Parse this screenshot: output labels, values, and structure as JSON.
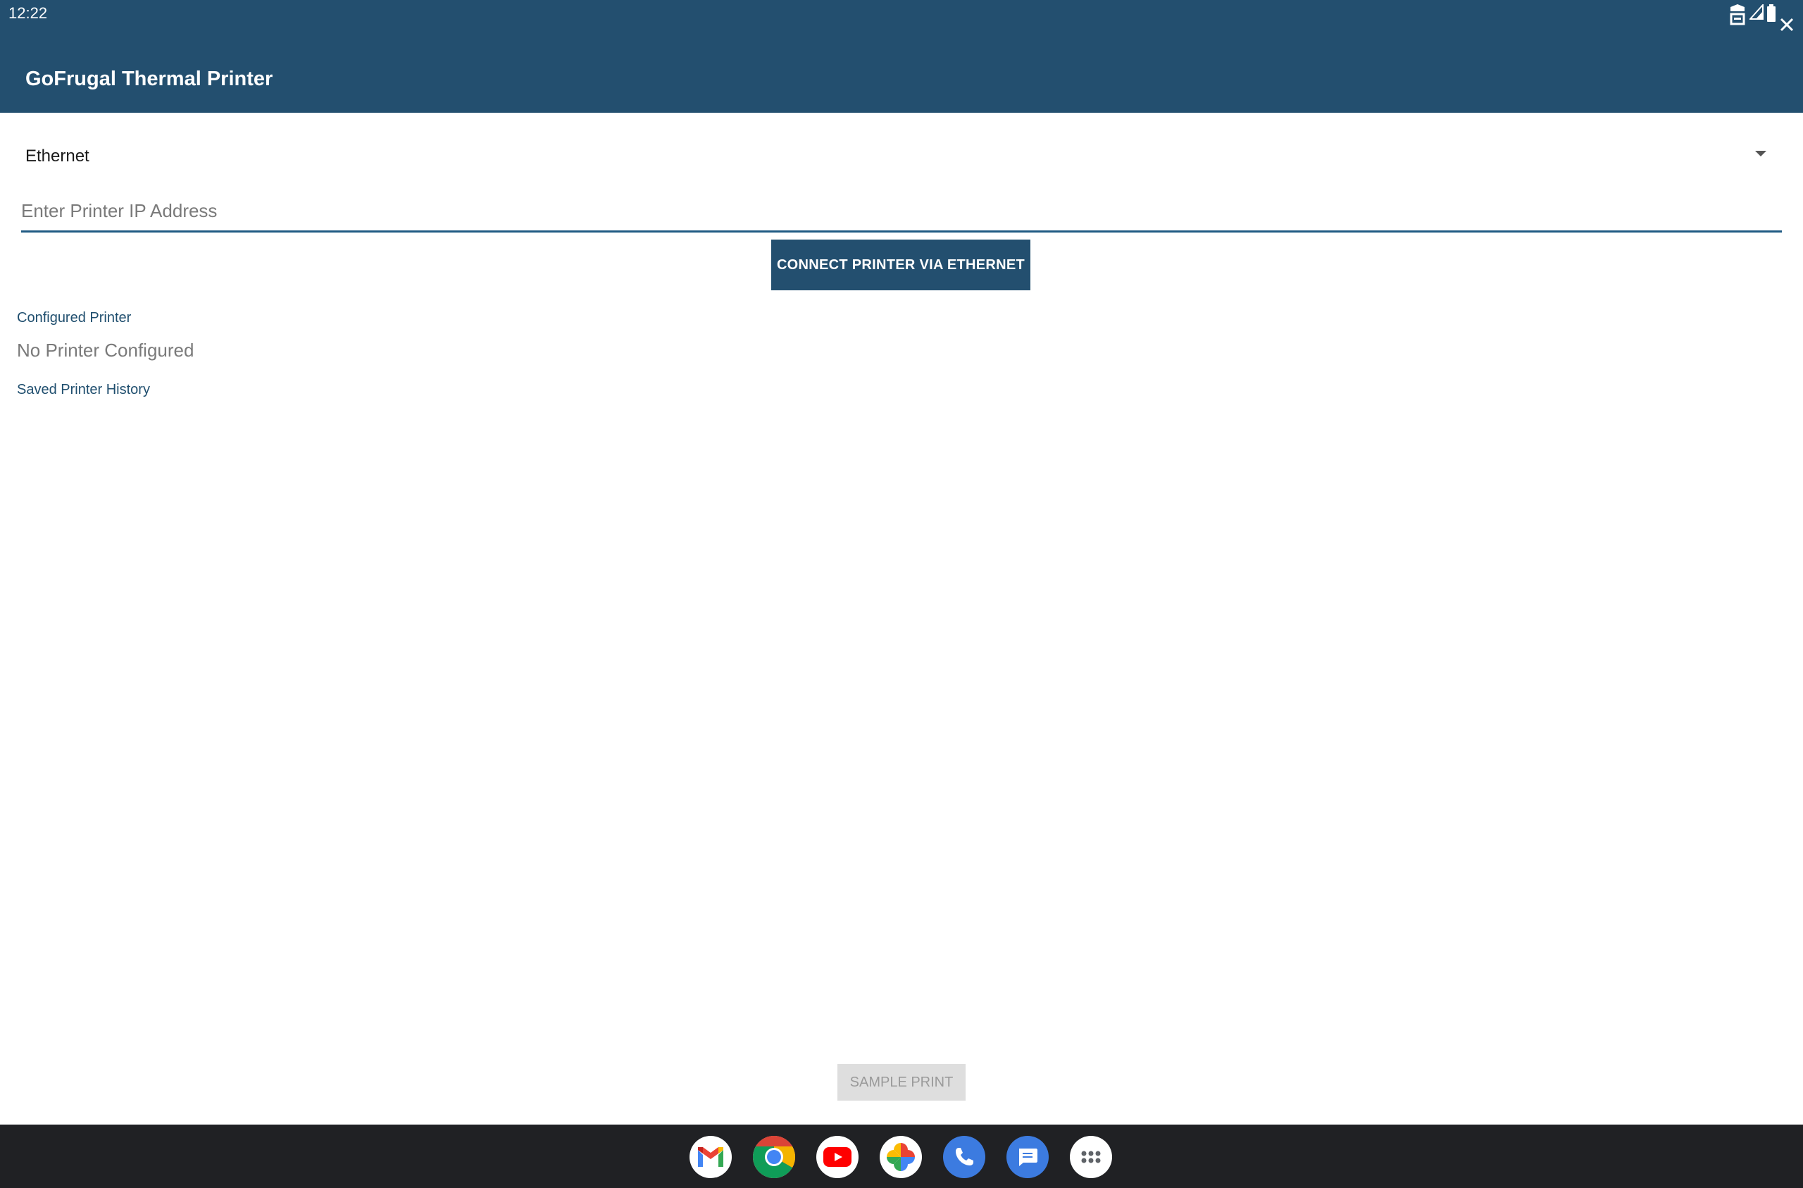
{
  "status_bar": {
    "time": "12:22"
  },
  "app": {
    "title": "GoFrugal Thermal Printer"
  },
  "connection": {
    "selected_type": "Ethernet",
    "ip_placeholder": "Enter Printer IP Address",
    "ip_value": "",
    "connect_label": "CONNECT PRINTER VIA ETHERNET"
  },
  "configured": {
    "label": "Configured Printer",
    "value": "No Printer Configured"
  },
  "history": {
    "label": "Saved Printer History"
  },
  "sample_print": {
    "label": "SAMPLE PRINT"
  },
  "taskbar": {
    "apps": [
      "gmail-icon",
      "chrome-icon",
      "youtube-icon",
      "photos-icon",
      "phone-icon",
      "messages-icon",
      "app-launcher-icon"
    ]
  },
  "colors": {
    "primary": "#234f6f",
    "accent_line": "#1f5a83",
    "label_text": "#1f4e6e",
    "muted_text": "#7a7a7a",
    "disabled_bg": "#dedede",
    "taskbar_bg": "#202124"
  }
}
